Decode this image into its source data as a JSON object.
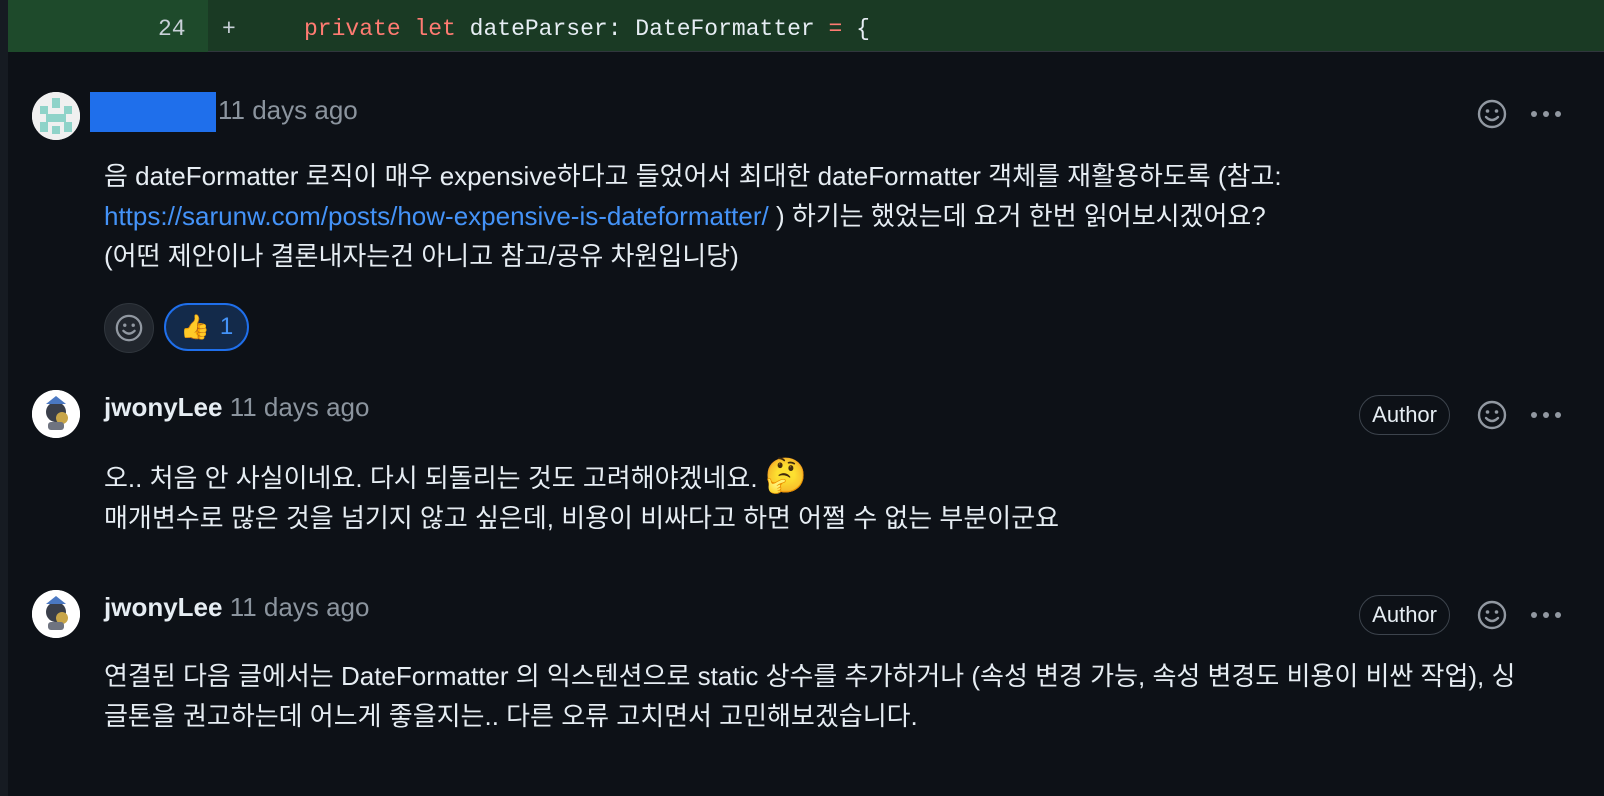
{
  "diff": {
    "line_number": "24",
    "marker": "+",
    "code_kw1": "private",
    "code_kw2": "let",
    "code_rest": "dateParser: DateFormatter",
    "code_op": "=",
    "code_brace": "{"
  },
  "comments": [
    {
      "username": "",
      "timestamp": "11 days ago",
      "body_line1": "음 dateFormatter 로직이 매우 expensive하다고 들었어서 최대한 dateFormatter 객체를 재활용하도록 (참고:",
      "link": "https://sarunw.com/posts/how-expensive-is-dateformatter/",
      "body_line2_rest": " ) 하기는 했었는데 요거 한번 읽어보시겠어요?",
      "body_line3": "(어떤 제안이나 결론내자는건 아니고 참고/공유 차원입니당)",
      "reaction_emoji": "👍",
      "reaction_count": "1"
    },
    {
      "username": "jwonyLee",
      "timestamp": "11 days ago",
      "badge": "Author",
      "body_line1": "오.. 처음 안 사실이네요. 다시 되돌리는 것도 고려해야겠네요.",
      "emoji": "🤔",
      "body_line2": "매개변수로 많은 것을 넘기지 않고 싶은데, 비용이 비싸다고 하면 어쩔 수 없는 부분이군요"
    },
    {
      "username": "jwonyLee",
      "timestamp": "11 days ago",
      "badge": "Author",
      "body_line1": "연결된 다음 글에서는 DateFormatter 의 익스텐션으로 static 상수를 추가하거나 (속성 변경 가능, 속성 변경도 비용이 비싼 작업), 싱",
      "body_line2": "글톤을 권고하는데 어느게 좋을지는.. 다른 오류 고치면서 고민해보겠습니다."
    }
  ],
  "icons": {
    "smiley": "smiley-icon",
    "kebab": "kebab-menu-icon"
  },
  "colors": {
    "background": "#0d1117",
    "link": "#4493f8",
    "redaction": "#1f6feb",
    "diff_added": "#1a3a24"
  }
}
